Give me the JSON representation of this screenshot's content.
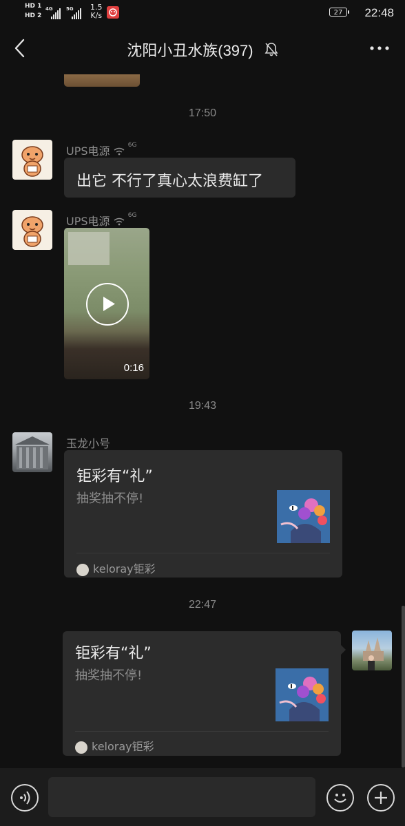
{
  "status_bar": {
    "sim1": "HD 1",
    "sim2": "HD 2",
    "net1": "4G",
    "net2": "5G",
    "speed_value": "1.5",
    "speed_unit": "K/s",
    "battery": "27",
    "time": "22:48"
  },
  "header": {
    "title": "沈阳小丑水族(397)"
  },
  "messages": {
    "time1": "17:50",
    "msg1": {
      "sender": "UPS电源",
      "net": "6G",
      "text": "出它 不行了真心太浪费缸了"
    },
    "msg2": {
      "sender": "UPS电源",
      "net": "6G",
      "video_duration": "0:16"
    },
    "time2": "19:43",
    "msg3": {
      "sender": "玉龙小号",
      "card_title": "钜彩有“礼”",
      "card_desc": "抽奖抽不停!",
      "card_source": "keloray钜彩"
    },
    "time3": "22:47",
    "msg4": {
      "card_title": "钜彩有“礼”",
      "card_desc": "抽奖抽不停!",
      "card_source": "keloray钜彩"
    }
  },
  "icons": {
    "back": "back-arrow-icon",
    "mute": "bell-off-icon",
    "more": "more-icon",
    "voice": "voice-icon",
    "emoji": "emoji-icon",
    "plus": "plus-icon",
    "play": "play-icon"
  },
  "colors": {
    "background": "#111111",
    "bubble": "#2b2b2b",
    "text": "#e6e6e6",
    "secondary_text": "#8c8c8c"
  }
}
